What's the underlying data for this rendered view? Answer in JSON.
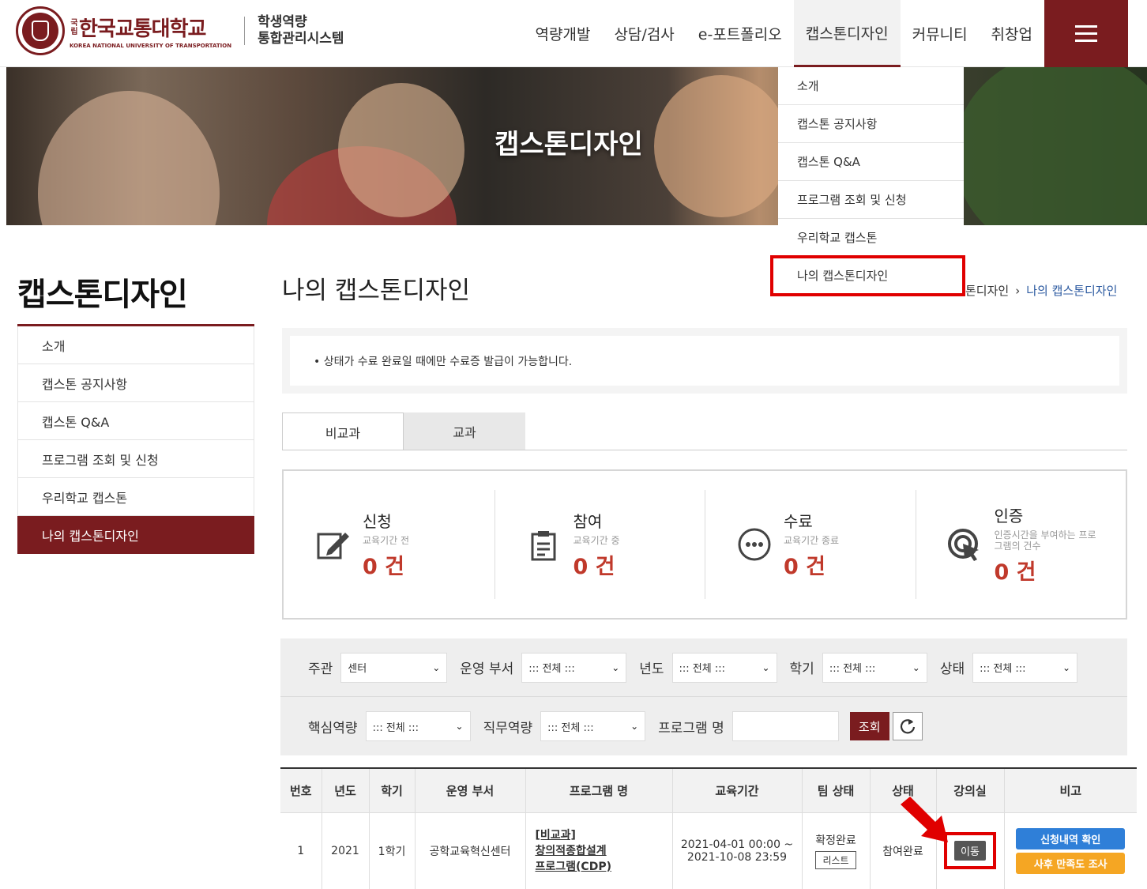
{
  "header": {
    "univ_prefix": "국립",
    "univ_name": "한국교통대학교",
    "univ_name_en": "KOREA NATIONAL UNIVERSITY OF TRANSPORTATION",
    "system_name_line1": "학생역량",
    "system_name_line2": "통합관리시스템",
    "nav": [
      "역량개발",
      "상담/검사",
      "e-포트폴리오",
      "캡스톤디자인",
      "커뮤니티",
      "취창업"
    ],
    "active_nav_index": 3
  },
  "hero": {
    "title": "캡스톤디자인"
  },
  "dropdown": {
    "items": [
      "소개",
      "캡스톤 공지사항",
      "캡스톤 Q&A",
      "프로그램 조회 및 신청",
      "우리학교 캡스톤",
      "나의 캡스톤디자인"
    ],
    "highlight_index": 5
  },
  "sidebar": {
    "title": "캡스톤디자인",
    "items": [
      "소개",
      "캡스톤 공지사항",
      "캡스톤 Q&A",
      "프로그램 조회 및 신청",
      "우리학교 캡스톤",
      "나의 캡스톤디자인"
    ],
    "active_index": 5
  },
  "main": {
    "title": "나의 캡스톤디자인",
    "breadcrumb": [
      "톤디자인",
      "나의 캡스톤디자인"
    ],
    "notice": "• 상태가 수료 완료일 때에만 수료증 발급이 가능합니다.",
    "tabs": [
      "비교과",
      "교과"
    ],
    "active_tab": 0
  },
  "stats": [
    {
      "label": "신청",
      "sub": "교육기간 전",
      "count": "0 건",
      "icon": "edit-icon"
    },
    {
      "label": "참여",
      "sub": "교육기간 중",
      "count": "0 건",
      "icon": "clipboard-icon"
    },
    {
      "label": "수료",
      "sub": "교육기간 종료",
      "count": "0 건",
      "icon": "more-circle-icon"
    },
    {
      "label": "인증",
      "sub": "인증시간을 부여하는 프로그램의 건수",
      "count": "0 건",
      "icon": "cursor-click-icon"
    }
  ],
  "filters": {
    "host_label": "주관",
    "host_value": "센터",
    "dept_label": "운영 부서",
    "dept_value": "::: 전체 :::",
    "year_label": "년도",
    "year_value": "::: 전체 :::",
    "semester_label": "학기",
    "semester_value": "::: 전체 :::",
    "status_label": "상태",
    "status_value": "::: 전체 :::",
    "core_label": "핵심역량",
    "core_value": "::: 전체 :::",
    "job_label": "직무역량",
    "job_value": "::: 전체 :::",
    "program_label": "프로그램 명",
    "program_value": "",
    "search_button": "조회"
  },
  "table": {
    "headers": [
      "번호",
      "년도",
      "학기",
      "운영 부서",
      "프로그램 명",
      "교육기간",
      "팀 상태",
      "상태",
      "강의실",
      "비고"
    ],
    "rows": [
      {
        "no": "1",
        "year": "2021",
        "semester": "1학기",
        "dept": "공학교육혁신센터",
        "program_line1": "[비교과]",
        "program_line2": "창의적종합설계",
        "program_line3": "프로그램(CDP)",
        "period_line1": "2021-04-01 00:00 ~",
        "period_line2": "2021-10-08 23:59",
        "team_status": "확정완료",
        "team_list_button": "리스트",
        "status": "참여완료",
        "classroom_button": "이동",
        "note_button1": "신청내역 확인",
        "note_button2": "사후 만족도 조사"
      }
    ]
  },
  "colors": {
    "brand": "#7a1c1f",
    "highlight": "#e00000",
    "count": "#c0392b",
    "blue": "#2f7fd8",
    "orange": "#f5a623"
  }
}
